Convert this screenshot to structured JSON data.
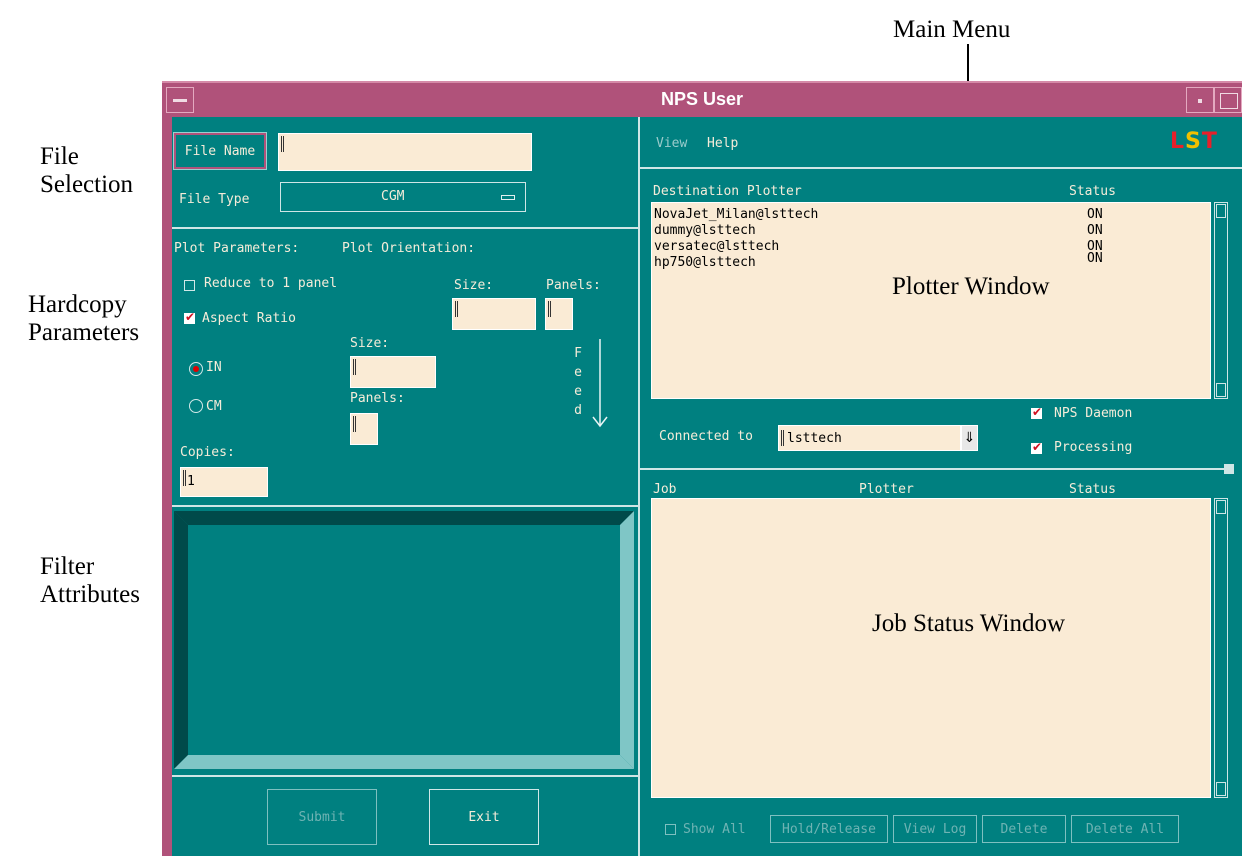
{
  "annotations": {
    "main_menu": "Main Menu",
    "file_selection": [
      "File",
      "Selection"
    ],
    "hardcopy_parameters": [
      "Hardcopy",
      "Parameters"
    ],
    "filter_attributes": [
      "Filter",
      "Attributes"
    ],
    "plotter_window": "Plotter Window",
    "job_status_window": "Job Status Window"
  },
  "window": {
    "title": "NPS User"
  },
  "file_section": {
    "file_name_button": "File Name",
    "file_name_value": "",
    "file_type_label": "File Type",
    "file_type_value": "CGM"
  },
  "plot": {
    "parameters_label": "Plot Parameters:",
    "orientation_label": "Plot Orientation:",
    "reduce_label": "Reduce to 1 panel",
    "reduce_checked": false,
    "aspect_label": "Aspect Ratio",
    "aspect_checked": true,
    "size_label": "Size:",
    "panels_label": "Panels:",
    "in_label": "IN",
    "cm_label": "CM",
    "unit_selected": "IN",
    "feed_letters": [
      "F",
      "e",
      "e",
      "d"
    ],
    "copies_label": "Copies:",
    "copies_value": "1"
  },
  "buttons": {
    "submit": "Submit",
    "exit": "Exit"
  },
  "menu": {
    "view": "View",
    "help": "Help",
    "logo": [
      "L",
      "S",
      "T"
    ]
  },
  "plotters": {
    "header_destination": "Destination Plotter",
    "header_status": "Status",
    "rows": [
      {
        "name": "NovaJet_Milan@lsttech",
        "status": "ON"
      },
      {
        "name": "dummy@lsttech",
        "status": "ON"
      },
      {
        "name": "versatec@lsttech",
        "status": "ON"
      },
      {
        "name": "hp750@lsttech",
        "status": "ON"
      }
    ]
  },
  "connection": {
    "label": "Connected to",
    "value": "lsttech",
    "nps_daemon": "NPS Daemon",
    "processing": "Processing"
  },
  "jobs": {
    "header_job": "Job",
    "header_plotter": "Plotter",
    "header_status": "Status",
    "show_all": "Show All",
    "hold_release": "Hold/Release",
    "view_log": "View Log",
    "delete": "Delete",
    "delete_all": "Delete All"
  },
  "colors": {
    "panel": "#008080",
    "title_bar": "#b0527a",
    "field": "#faebd5",
    "logo_red": "#e8202a",
    "logo_yellow": "#f0c000"
  }
}
